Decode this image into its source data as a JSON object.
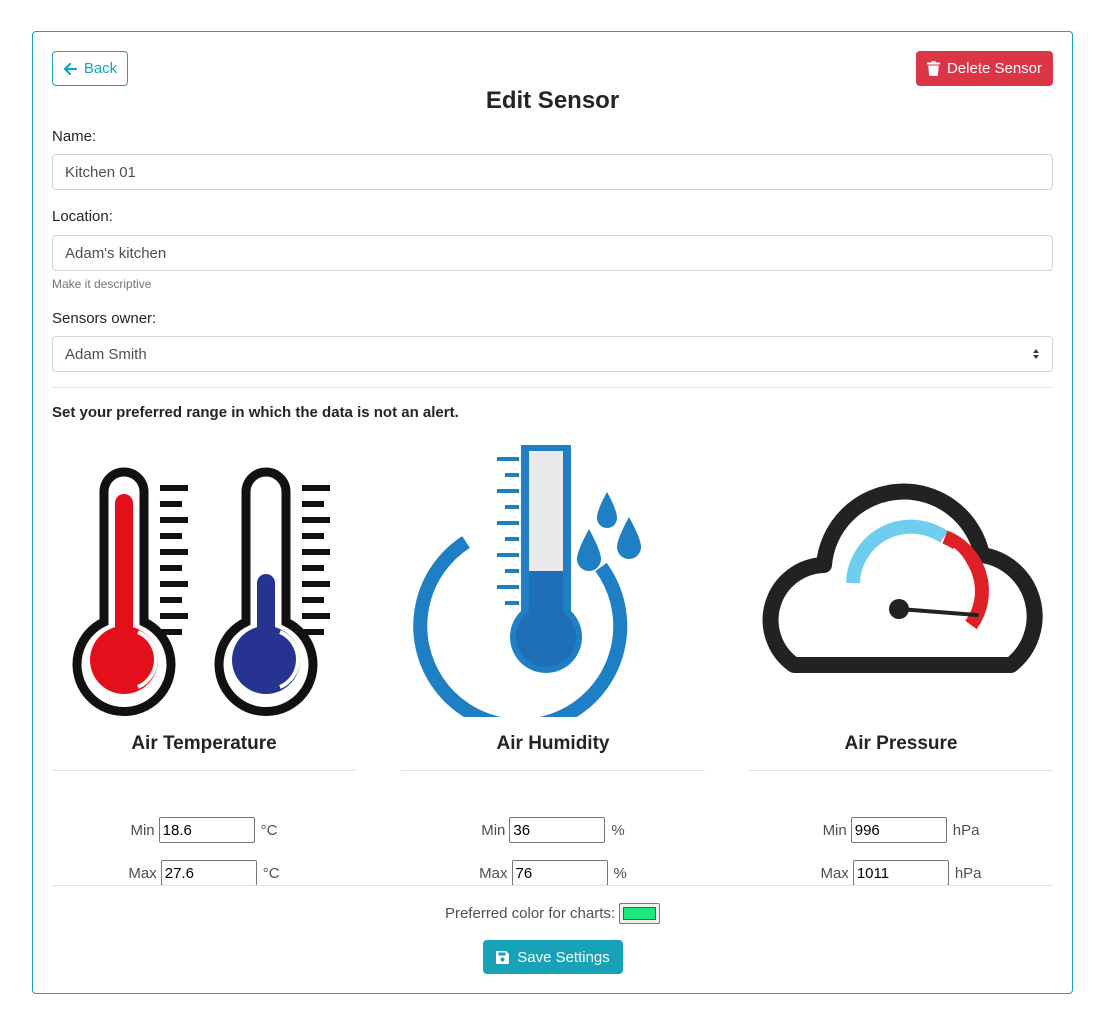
{
  "header": {
    "back_label": "Back",
    "delete_label": "Delete Sensor",
    "title": "Edit Sensor"
  },
  "form": {
    "name_label": "Name:",
    "name_value": "Kitchen 01",
    "location_label": "Location:",
    "location_value": "Adam's kitchen",
    "location_help": "Make it descriptive",
    "owner_label": "Sensors owner:",
    "owner_value": "Adam Smith"
  },
  "ranges": {
    "intro": "Set your preferred range in which the data is not an alert.",
    "min_label": "Min",
    "max_label": "Max",
    "temperature": {
      "title": "Air Temperature",
      "min": "18.6",
      "max": "27.6",
      "unit": "°C"
    },
    "humidity": {
      "title": "Air Humidity",
      "min": "36",
      "max": "76",
      "unit": "%"
    },
    "pressure": {
      "title": "Air Pressure",
      "min": "996",
      "max": "1011",
      "unit": "hPa"
    }
  },
  "chart_color": {
    "label": "Preferred color for charts:",
    "value": "#1ee87a"
  },
  "footer": {
    "save_label": "Save Settings"
  },
  "colors": {
    "accent": "#17a2b8",
    "danger": "#dc3545"
  }
}
